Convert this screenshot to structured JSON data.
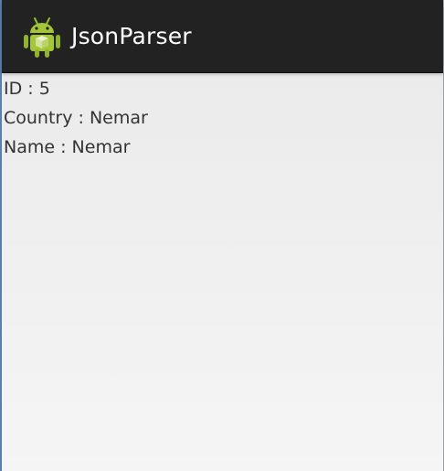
{
  "app": {
    "title": "JsonParser",
    "icon": "android-app-icon",
    "colors": {
      "action_bar": "#222222",
      "title_text": "#ffffff",
      "body_text": "#333333",
      "icon_green": "#97c024"
    }
  },
  "details": [
    {
      "label": "ID",
      "separator": " : ",
      "value": "5"
    },
    {
      "label": "Country",
      "separator": " : ",
      "value": "Nemar"
    },
    {
      "label": "Name",
      "separator": " : ",
      "value": "Nemar"
    }
  ]
}
